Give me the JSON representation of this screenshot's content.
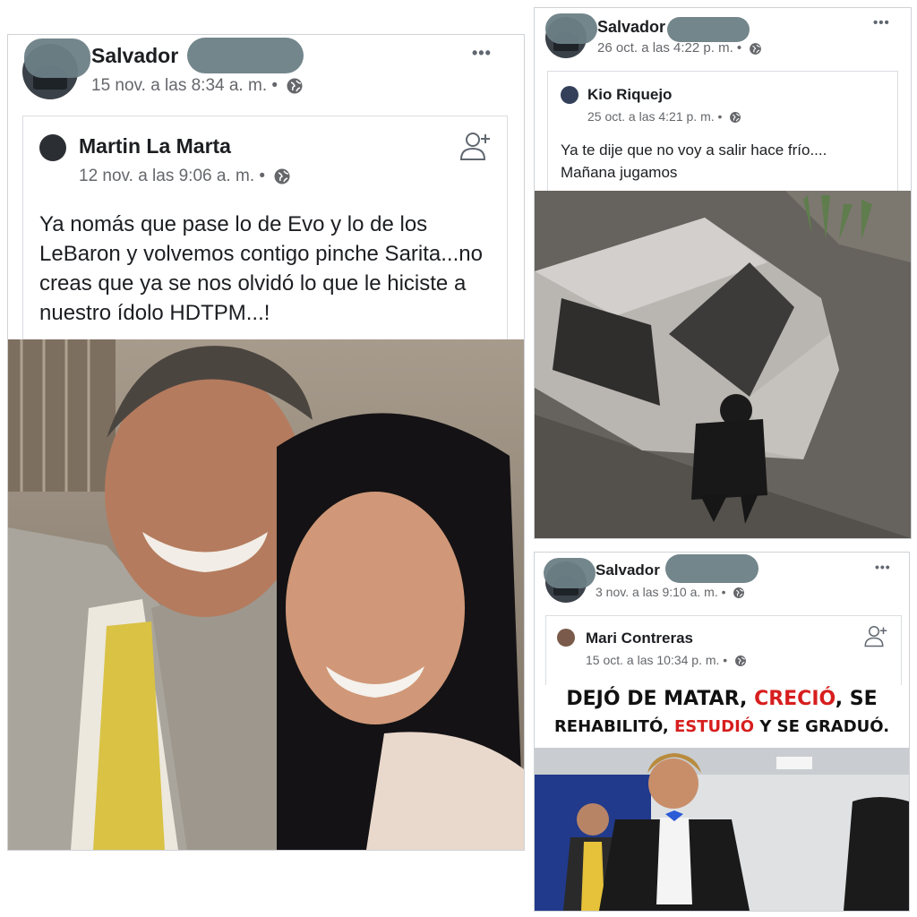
{
  "post1": {
    "author": "Salvador",
    "timestamp": "15 nov. a las 8:34 a. m. •",
    "shared": {
      "author": "Martin La Marta",
      "timestamp": "12 nov. a las 9:06 a. m. •",
      "text": "Ya nomás que pase lo de Evo y lo de los LeBaron y volvemos contigo pinche Sarita...no creas que ya se nos olvidó lo que le hiciste a nuestro ídolo HDTPM...!"
    }
  },
  "post2": {
    "author": "Salvador",
    "timestamp": "26 oct. a las 4:22 p. m. •",
    "shared": {
      "author": "Kio Riquejo",
      "timestamp": "25 oct. a las 4:21 p. m. •",
      "text_line1": "Ya te dije que no voy a salir hace frío....",
      "text_line2": "Mañana jugamos"
    }
  },
  "post3": {
    "author": "Salvador",
    "timestamp": "3 nov. a las 9:10 a. m. •",
    "shared": {
      "author": "Mari Contreras",
      "timestamp": "15 oct. a las 10:34 p. m. •"
    },
    "meme": {
      "l1_a": "DEJÓ DE MATAR, ",
      "l1_b": "CRECIÓ",
      "l1_c": ", SE",
      "l2_a": "REHABILITÓ, ",
      "l2_b": "ESTUDIÓ",
      "l2_c": " Y SE GRADUÓ."
    }
  },
  "more_label": "•••",
  "colors": {
    "link_text": "#1c1e21",
    "meta": "#65676b",
    "meme_red": "#d71e1e",
    "redaction": "#6b7f86"
  }
}
